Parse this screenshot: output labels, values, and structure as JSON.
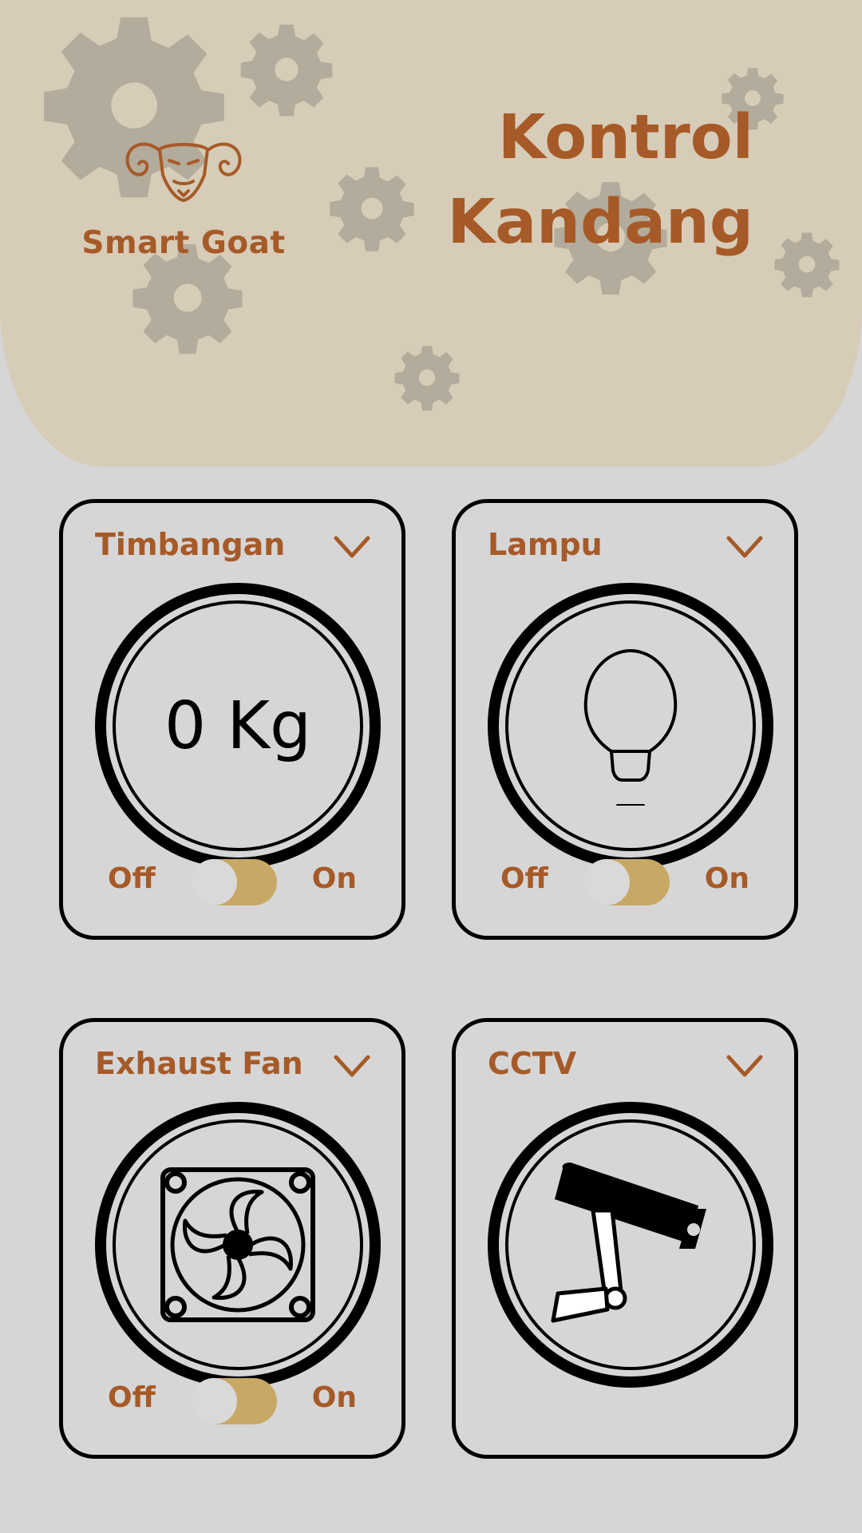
{
  "header": {
    "brand": "Smart Goat",
    "title_line1": "Kontrol",
    "title_line2": "Kandang"
  },
  "cards": [
    {
      "title": "Timbangan",
      "value": "0 Kg",
      "toggle": {
        "off": "Off",
        "on": "On",
        "state": "off"
      }
    },
    {
      "title": "Lampu",
      "toggle": {
        "off": "Off",
        "on": "On",
        "state": "off"
      }
    },
    {
      "title": "Exhaust Fan",
      "toggle": {
        "off": "Off",
        "on": "On",
        "state": "off"
      }
    },
    {
      "title": "CCTV"
    }
  ],
  "colors": {
    "accent": "#a65a28",
    "header_bg": "#d7ccb7",
    "page_bg": "#d6d6d6",
    "switch_track": "#c8a865"
  }
}
